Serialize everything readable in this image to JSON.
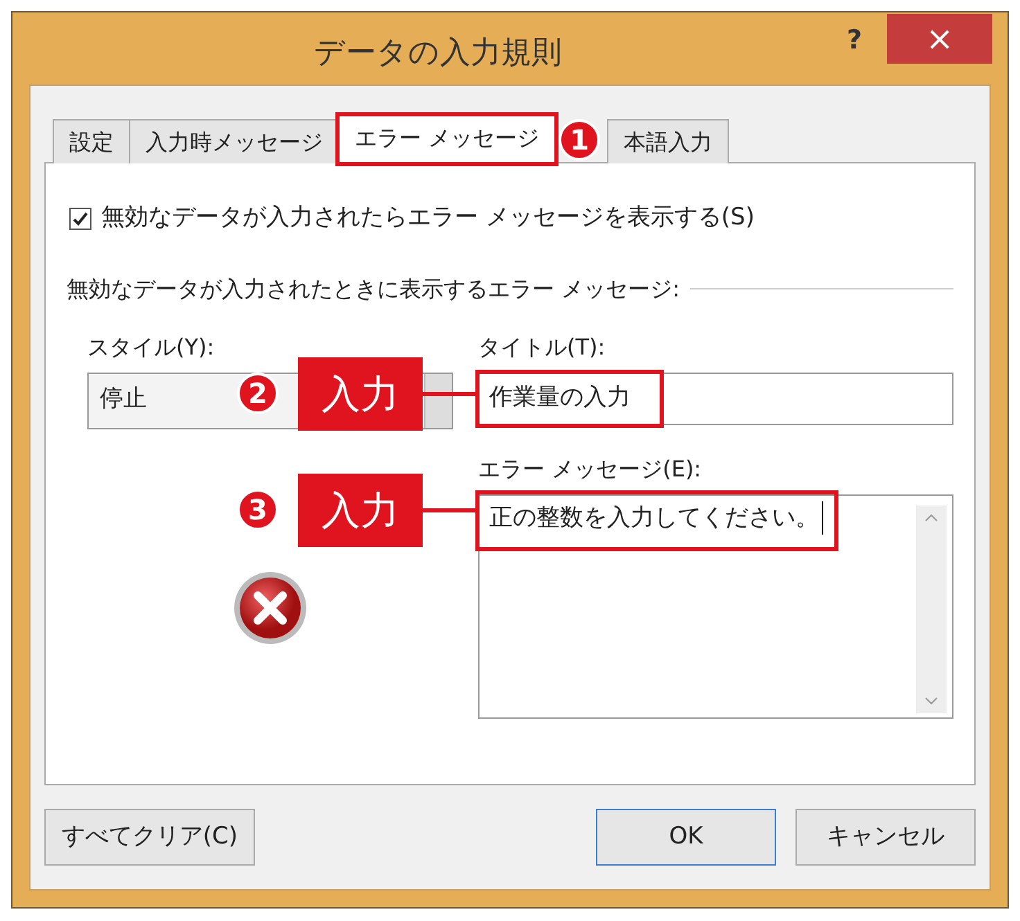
{
  "window": {
    "title": "データの入力規則",
    "help": "?",
    "close": "×"
  },
  "tabs": [
    {
      "label": "設定",
      "selected": false
    },
    {
      "label": "入力時メッセージ",
      "selected": false
    },
    {
      "label": "エラー メッセージ",
      "selected": true
    },
    {
      "label": "本語入力",
      "selected": false
    }
  ],
  "show_error": {
    "label": "無効なデータが入力されたらエラー メッセージを表示する(S)",
    "checked": true
  },
  "group_label": "無効なデータが入力されたときに表示するエラー メッセージ:",
  "style": {
    "label": "スタイル(Y):",
    "value": "停止"
  },
  "title_field": {
    "label": "タイトル(T):",
    "value": "作業量の入力"
  },
  "message_field": {
    "label": "エラー メッセージ(E):",
    "value": "正の整数を入力してください。"
  },
  "buttons": [
    {
      "label": "すべてクリア(C)",
      "default": false
    },
    {
      "label": "OK",
      "default": true
    },
    {
      "label": "キャンセル",
      "default": false
    }
  ],
  "annotations": [
    {
      "kind": "marker",
      "number": "1"
    },
    {
      "kind": "callout",
      "number": "2",
      "label": "入力"
    },
    {
      "kind": "callout",
      "number": "3",
      "label": "入力"
    }
  ]
}
